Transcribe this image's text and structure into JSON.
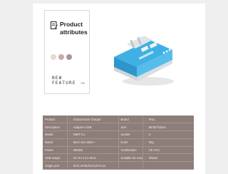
{
  "attributes": {
    "title_line1": "Product",
    "title_line2": "attributes",
    "feature_line1": "NEW",
    "feature_line2": "FEATURE",
    "swatches": [
      "#e8d8d2",
      "#c8aca4",
      "#a99892"
    ]
  },
  "colors": {
    "table_bg": "#8d7e7a",
    "accent_blue": "#3aa8dc"
  },
  "specs": [
    {
      "k1": "Product",
      "v1": "Global travel charger",
      "k2": "Brand",
      "v2": "Pro1"
    },
    {
      "k1": "Description",
      "v1": "Adapter+USB",
      "k2": "Size",
      "v2": "66*50*32mm"
    },
    {
      "k1": "Model",
      "v1": "N96T-C1",
      "k2": "Socket",
      "v2": "2"
    },
    {
      "k1": "Rated",
      "v1": "MAX 10A 250V~",
      "k2": "N.Wt",
      "v2": "50g"
    },
    {
      "k1": "Power",
      "v1": "2800W",
      "k2": "Certification",
      "v2": "CE FCC"
    },
    {
      "k1": "USB output",
      "v1": "DC 5V 3.1A MAX",
      "k2": "Suitable for Area",
      "v2": "Global"
    },
    {
      "k1": "Single port",
      "v1": "5V/2.4A/9V/2A/12V/1.5A",
      "k2": "",
      "v2": ""
    }
  ]
}
